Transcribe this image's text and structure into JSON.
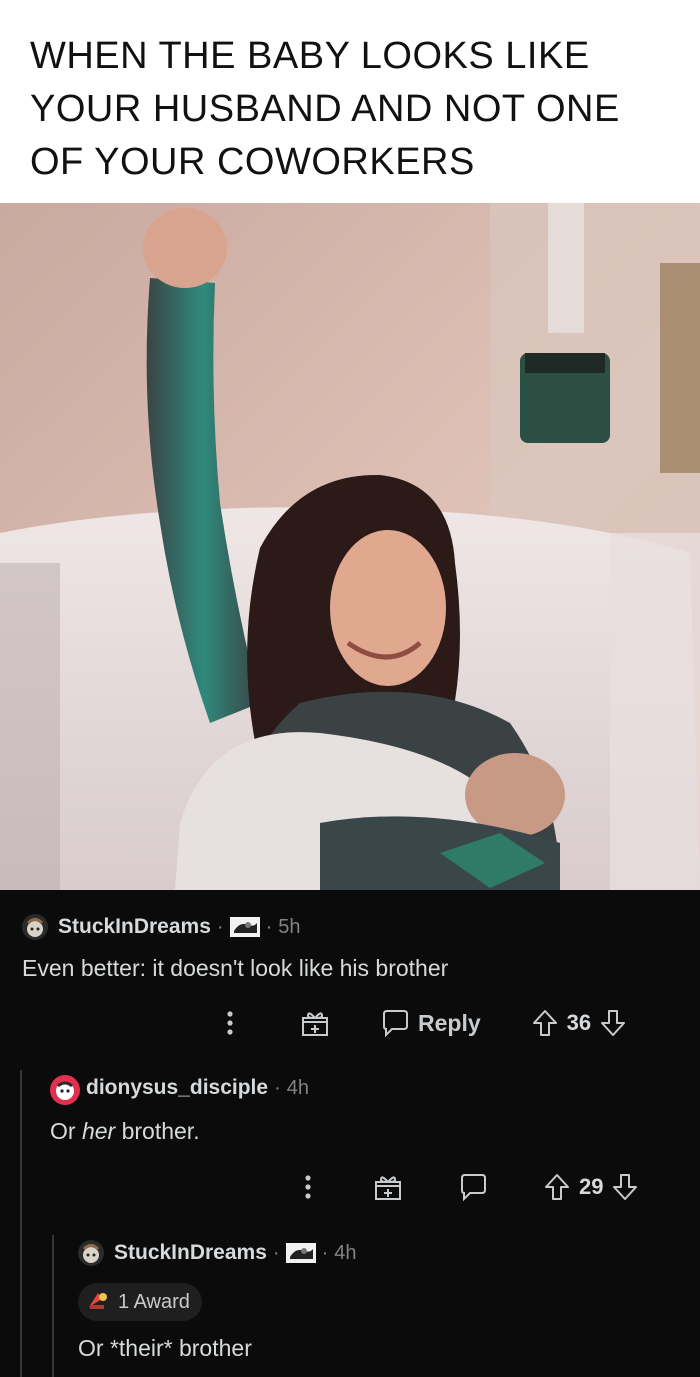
{
  "meme": {
    "caption": "WHEN THE BABY LOOKS LIKE YOUR HUSBAND AND NOT ONE OF YOUR COWORKERS"
  },
  "comments": [
    {
      "username": "StuckInDreams",
      "time": "5h",
      "body": "Even better: it doesn't look like his brother",
      "reply_label": "Reply",
      "score": "36"
    },
    {
      "username": "dionysus_disciple",
      "time": "4h",
      "body_prefix": "Or ",
      "body_emph": "her",
      "body_suffix": " brother.",
      "score": "29"
    },
    {
      "username": "StuckInDreams",
      "time": "4h",
      "award_label": "1 Award",
      "body": "Or *their* brother"
    }
  ],
  "icons": [
    "overflow-menu-icon",
    "gift-icon",
    "comment-bubble-icon",
    "upvote-arrow-icon",
    "downvote-arrow-icon",
    "award-icon",
    "user-avatar-icon",
    "user-flair-icon"
  ],
  "colors": {
    "background": "#0b0b0b",
    "text": "#d7dadc",
    "muted": "#818384"
  }
}
